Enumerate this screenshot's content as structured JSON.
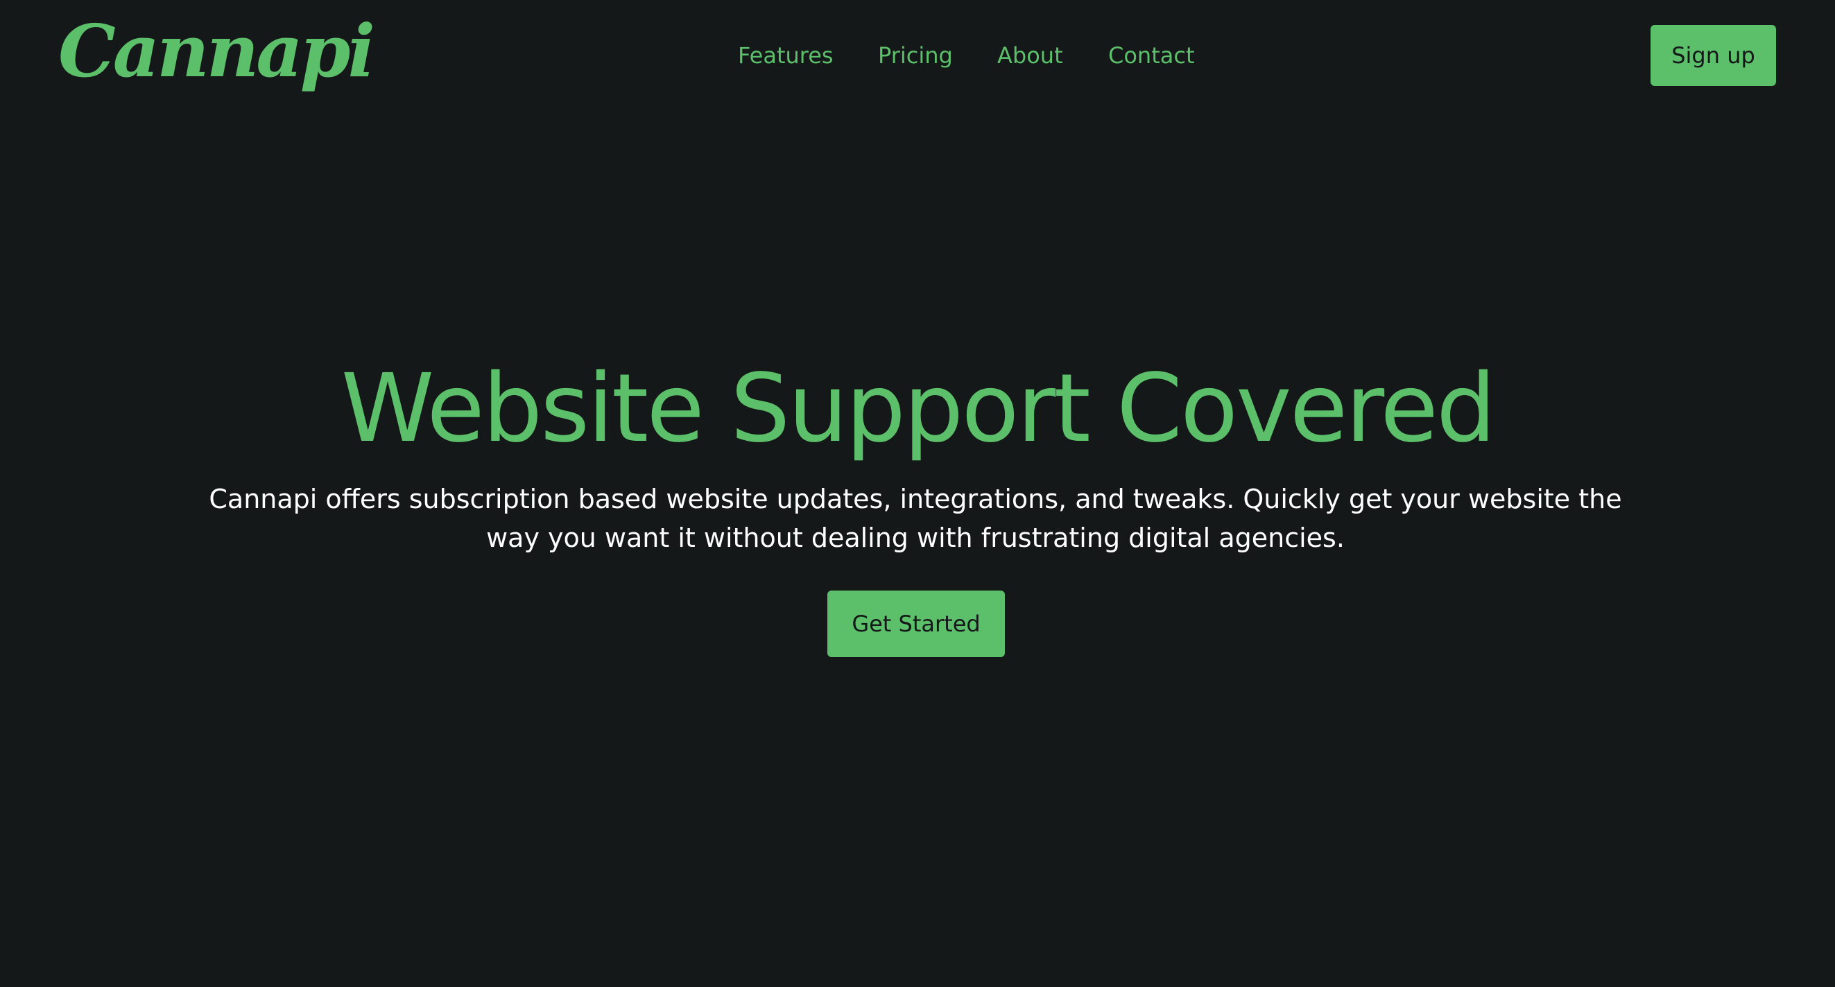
{
  "brand": {
    "logo_text": "Cannapi"
  },
  "nav": {
    "items": [
      {
        "label": "Features"
      },
      {
        "label": "Pricing"
      },
      {
        "label": "About"
      },
      {
        "label": "Contact"
      }
    ],
    "signup_label": "Sign up"
  },
  "hero": {
    "title": "Website Support Covered",
    "description": "Cannapi offers subscription based website updates, integrations, and tweaks. Quickly get your website the way you want it without dealing with frustrating digital agencies.",
    "cta_label": "Get Started"
  },
  "colors": {
    "background": "#141819",
    "accent": "#5cbf69",
    "text": "#ffffff"
  }
}
